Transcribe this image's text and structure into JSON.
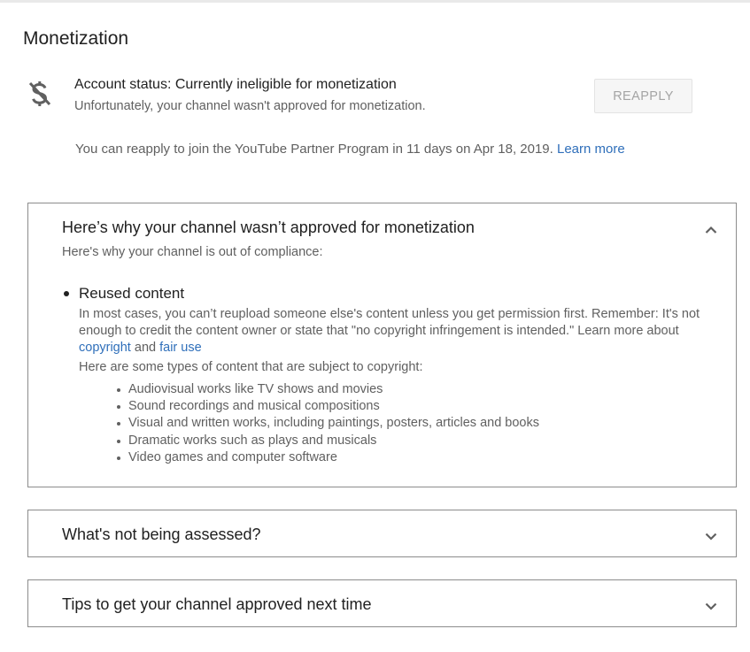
{
  "page": {
    "title": "Monetization"
  },
  "account": {
    "icon": "no-money-icon",
    "status_title": "Account status: Currently ineligible for monetization",
    "status_subtitle": "Unfortunately, your channel wasn't approved for monetization.",
    "reapply_button": "REAPPLY",
    "reapply_text": "You can reapply to join the YouTube Partner Program in 11 days on Apr 18, 2019.",
    "learn_more": "Learn more"
  },
  "panels": [
    {
      "title": "Here’s why your channel wasn’t approved for monetization",
      "expanded": true,
      "intro": "Here's why your channel is out of compliance:",
      "item_title": "Reused content",
      "item_desc": "In most cases, you can’t reupload someone else's content unless you get permission first. Remember: It's not enough to credit the content owner or state that \"no copyright infringement is intended.\" Learn more about",
      "link_copyright": "copyright",
      "and_text": "and",
      "link_fair_use": "fair use",
      "types_intro": "Here are some types of content that are subject to copyright:",
      "types": [
        "Audiovisual works like TV shows and movies",
        "Sound recordings and musical compositions",
        "Visual and written works, including paintings, posters, articles and books",
        "Dramatic works such as plays and musicals",
        "Video games and computer software"
      ]
    },
    {
      "title": "What's not being assessed?",
      "expanded": false
    },
    {
      "title": "Tips to get your channel approved next time",
      "expanded": false
    }
  ],
  "colors": {
    "link": "#2f6fba",
    "secondary_text": "#606060",
    "primary_text": "#212121",
    "border": "#8c8c8c"
  }
}
